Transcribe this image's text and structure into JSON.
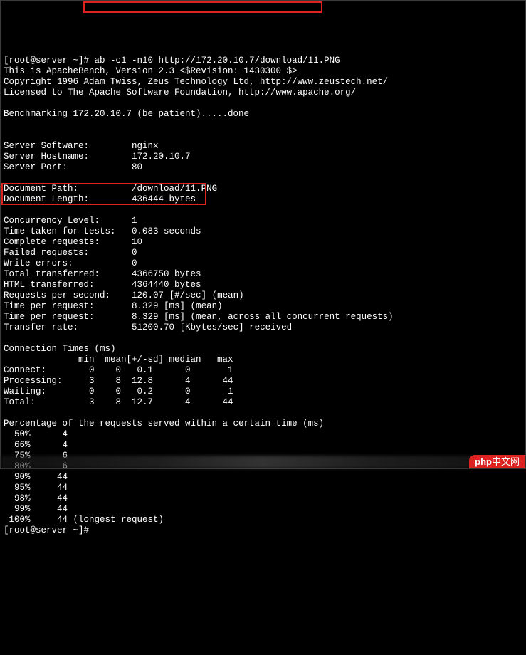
{
  "prompt": {
    "user_host": "[root@server ~]#",
    "command": "ab -c1 -n10 http://172.20.10.7/download/11.PNG"
  },
  "header": {
    "line1": "This is ApacheBench, Version 2.3 <$Revision: 1430300 $>",
    "line2": "Copyright 1996 Adam Twiss, Zeus Technology Ltd, http://www.zeustech.net/",
    "line3": "Licensed to The Apache Software Foundation, http://www.apache.org/"
  },
  "benchmark_line": "Benchmarking 172.20.10.7 (be patient).....done",
  "server": {
    "software_label": "Server Software:",
    "software_value": "nginx",
    "hostname_label": "Server Hostname:",
    "hostname_value": "172.20.10.7",
    "port_label": "Server Port:",
    "port_value": "80"
  },
  "document": {
    "path_label": "Document Path:",
    "path_value": "/download/11.PNG",
    "length_label": "Document Length:",
    "length_value": "436444 bytes"
  },
  "results": {
    "concurrency_label": "Concurrency Level:",
    "concurrency_value": "1",
    "time_taken_label": "Time taken for tests:",
    "time_taken_value": "0.083 seconds",
    "complete_label": "Complete requests:",
    "complete_value": "10",
    "failed_label": "Failed requests:",
    "failed_value": "0",
    "write_errors_label": "Write errors:",
    "write_errors_value": "0",
    "total_transferred_label": "Total transferred:",
    "total_transferred_value": "4366750 bytes",
    "html_transferred_label": "HTML transferred:",
    "html_transferred_value": "4364440 bytes",
    "rps_label": "Requests per second:",
    "rps_value": "120.07 [#/sec] (mean)",
    "tpr1_label": "Time per request:",
    "tpr1_value": "8.329 [ms] (mean)",
    "tpr2_label": "Time per request:",
    "tpr2_value": "8.329 [ms] (mean, across all concurrent requests)",
    "transfer_label": "Transfer rate:",
    "transfer_value": "51200.70 [Kbytes/sec] received"
  },
  "conn_times": {
    "title": "Connection Times (ms)",
    "header": "              min  mean[+/-sd] median   max",
    "connect": "Connect:        0    0   0.1      0       1",
    "processing": "Processing:     3    8  12.8      4      44",
    "waiting": "Waiting:        0    0   0.2      0       1",
    "total": "Total:          3    8  12.7      4      44"
  },
  "percentiles": {
    "title": "Percentage of the requests served within a certain time (ms)",
    "p50": "  50%      4",
    "p66": "  66%      4",
    "p75": "  75%      6",
    "p80": "  80%      6",
    "p90": "  90%     44",
    "p95": "  95%     44",
    "p98": "  98%     44",
    "p99": "  99%     44",
    "p100": " 100%     44 (longest request)"
  },
  "final_prompt": "[root@server ~]#",
  "watermark": {
    "logo": "php",
    "text": "中文网"
  }
}
